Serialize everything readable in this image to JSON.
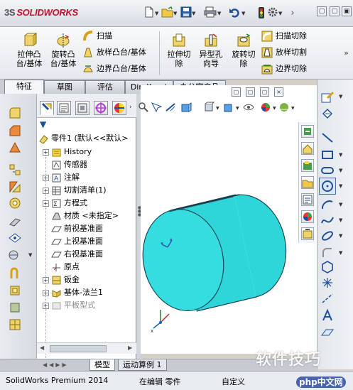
{
  "app": {
    "logo_prefix": "3S",
    "logo_text": "SOLIDWORKS"
  },
  "quick_access": {
    "icons": [
      "new-icon",
      "open-icon",
      "save-icon",
      "print-icon",
      "undo-icon",
      "rebuild-icon",
      "options-icon"
    ]
  },
  "window_buttons": [
    "▢",
    "▢",
    "▣"
  ],
  "command_manager": {
    "big": [
      {
        "id": "extruded-boss",
        "label_line1": "拉伸凸",
        "label_line2": "台/基体"
      },
      {
        "id": "revolved-boss",
        "label_line1": "旋转凸",
        "label_line2": "台/基体"
      }
    ],
    "small_left": [
      {
        "id": "sweep",
        "label": "扫描"
      },
      {
        "id": "loft",
        "label": "放样凸台/基体"
      },
      {
        "id": "boundary-boss",
        "label": "边界凸台/基体"
      }
    ],
    "big_cut": [
      {
        "id": "extruded-cut",
        "label_line1": "拉伸切",
        "label_line2": "除"
      },
      {
        "id": "hole-wizard",
        "label_line1": "异型孔",
        "label_line2": "向导"
      },
      {
        "id": "revolved-cut",
        "label_line1": "旋转切",
        "label_line2": "除"
      }
    ],
    "small_right": [
      {
        "id": "swept-cut",
        "label": "扫描切除"
      },
      {
        "id": "lofted-cut",
        "label": "放样切割"
      },
      {
        "id": "boundary-cut",
        "label": "边界切除"
      }
    ],
    "more": "»"
  },
  "tabs": [
    "特征",
    "草图",
    "评估",
    "DimXpert",
    "办公室产品"
  ],
  "active_tab": "特征",
  "tree": {
    "filter_icon": "filter-icon",
    "root": "零件1  (默认<<默认>",
    "items": [
      {
        "label": "History",
        "icon": "history-icon",
        "expandable": true
      },
      {
        "label": "传感器",
        "icon": "sensor-icon",
        "expandable": false
      },
      {
        "label": "注解",
        "icon": "annotation-icon",
        "expandable": true
      },
      {
        "label": "切割清单(1)",
        "icon": "cutlist-icon",
        "expandable": true
      },
      {
        "label": "方程式",
        "icon": "equation-icon",
        "expandable": true
      },
      {
        "label": "材质 <未指定>",
        "icon": "material-icon",
        "expandable": false
      },
      {
        "label": "前视基准面",
        "icon": "plane-icon",
        "expandable": false
      },
      {
        "label": "上视基准面",
        "icon": "plane-icon",
        "expandable": false
      },
      {
        "label": "右视基准面",
        "icon": "plane-icon",
        "expandable": false
      },
      {
        "label": "原点",
        "icon": "origin-icon",
        "expandable": false
      },
      {
        "label": "钣金",
        "icon": "sheetmetal-icon",
        "expandable": true
      },
      {
        "label": "基体-法兰1",
        "icon": "base-flange-icon",
        "expandable": true
      },
      {
        "label": "平板型式",
        "icon": "flat-pattern-icon",
        "expandable": true,
        "muted": true
      }
    ]
  },
  "bottom_tabs": [
    "模型",
    "运动算例 1"
  ],
  "active_bottom_tab": "模型",
  "status": {
    "product": "SolidWorks Premium 2014",
    "state": "在编辑 零件",
    "custom": "自定义"
  },
  "watermark": "软件技巧",
  "watermark_logo": "php中文网",
  "colors": {
    "cylinder": "#2ed6d9",
    "cylinder_edge": "#1a4a5a",
    "accent_blue": "#1f4f9d",
    "brand_red": "#c8102e"
  }
}
